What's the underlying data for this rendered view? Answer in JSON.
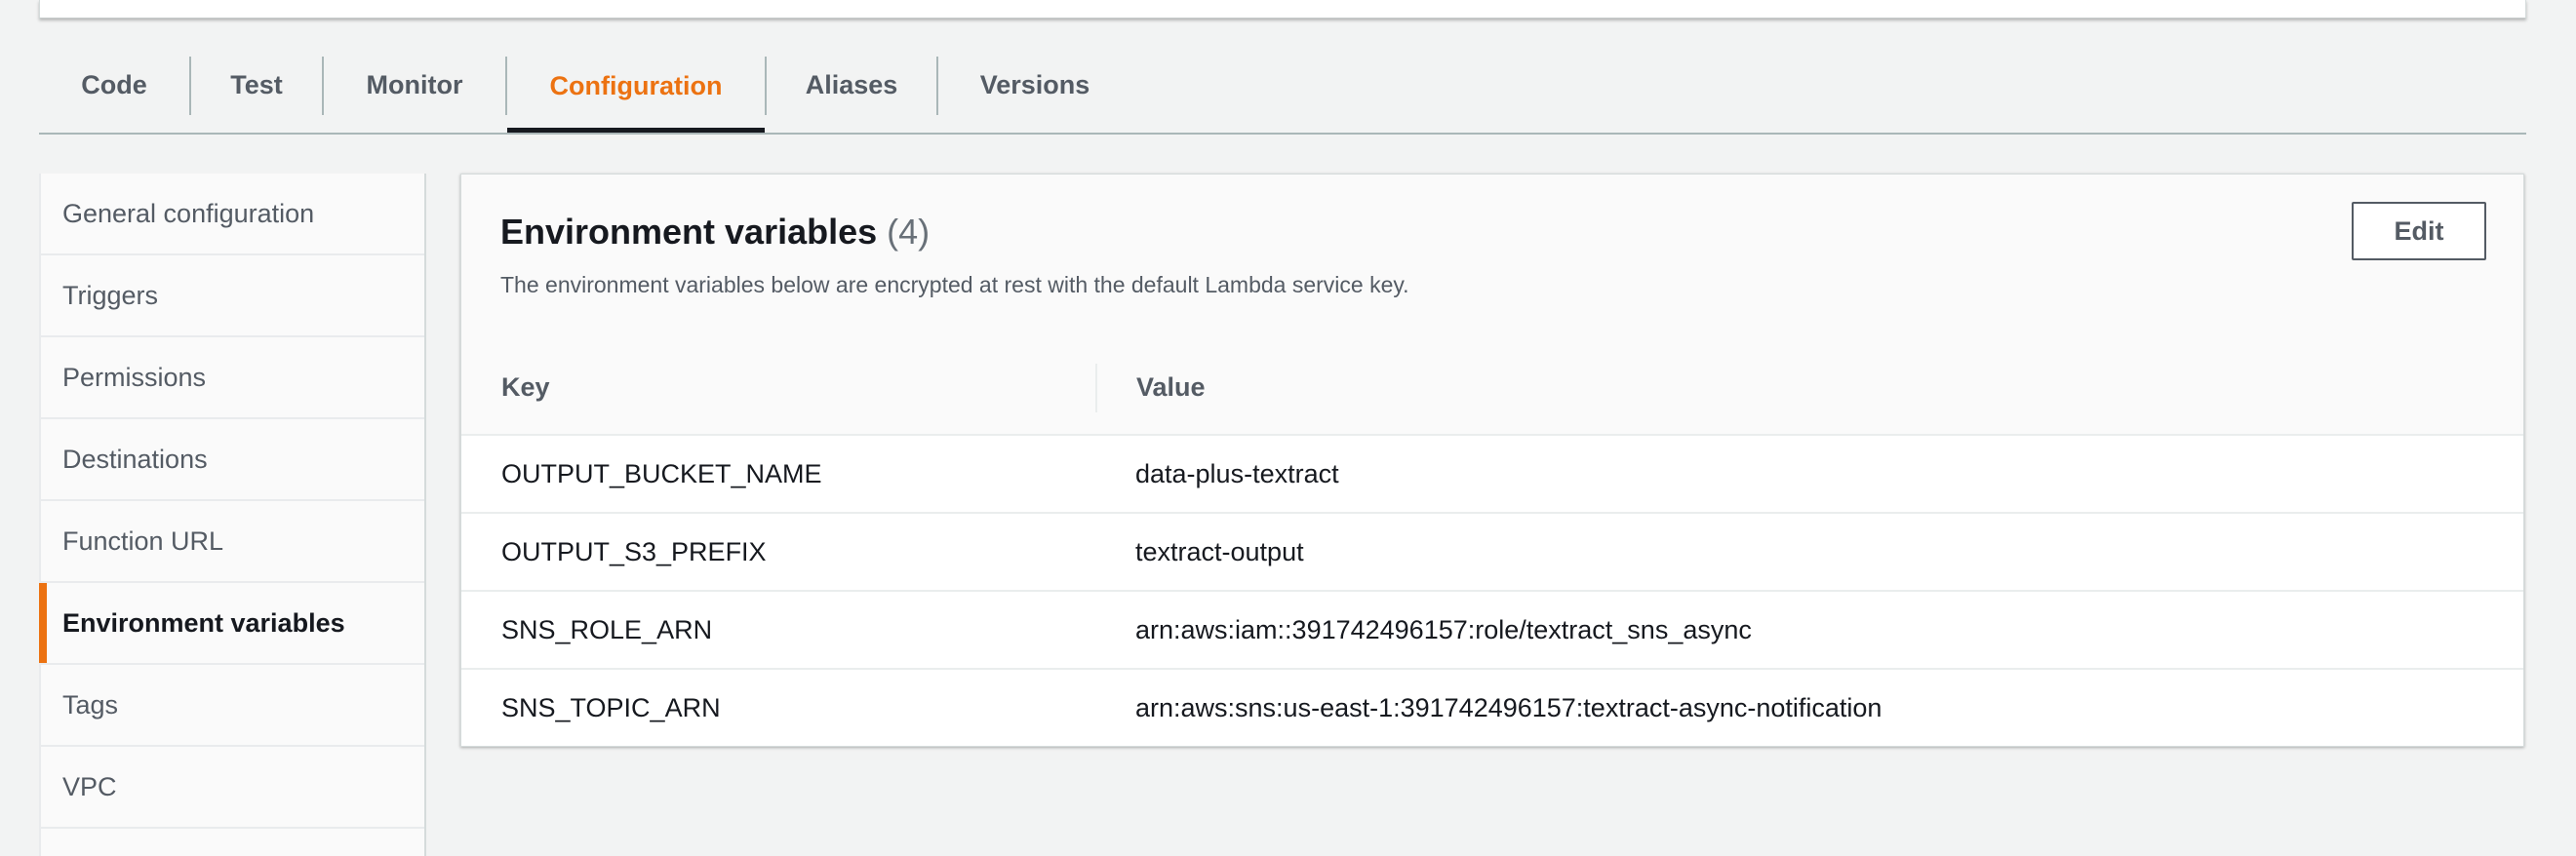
{
  "tabs": [
    {
      "label": "Code"
    },
    {
      "label": "Test"
    },
    {
      "label": "Monitor"
    },
    {
      "label": "Configuration"
    },
    {
      "label": "Aliases"
    },
    {
      "label": "Versions"
    }
  ],
  "active_tab": "Configuration",
  "sidebar": {
    "items": [
      {
        "label": "General configuration"
      },
      {
        "label": "Triggers"
      },
      {
        "label": "Permissions"
      },
      {
        "label": "Destinations"
      },
      {
        "label": "Function URL"
      },
      {
        "label": "Environment variables"
      },
      {
        "label": "Tags"
      },
      {
        "label": "VPC"
      }
    ],
    "active": "Environment variables"
  },
  "panel": {
    "title": "Environment variables",
    "count": "(4)",
    "description": "The environment variables below are encrypted at rest with the default Lambda service key.",
    "edit_label": "Edit",
    "columns": {
      "key": "Key",
      "value": "Value"
    },
    "rows": [
      {
        "key": "OUTPUT_BUCKET_NAME",
        "value": "data-plus-textract"
      },
      {
        "key": "OUTPUT_S3_PREFIX",
        "value": "textract-output"
      },
      {
        "key": "SNS_ROLE_ARN",
        "value": "arn:aws:iam::391742496157:role/textract_sns_async"
      },
      {
        "key": "SNS_TOPIC_ARN",
        "value": "arn:aws:sns:us-east-1:391742496157:textract-async-notification"
      }
    ]
  },
  "colors": {
    "accent": "#ec7211",
    "text": "#16191f",
    "muted": "#545b64"
  }
}
